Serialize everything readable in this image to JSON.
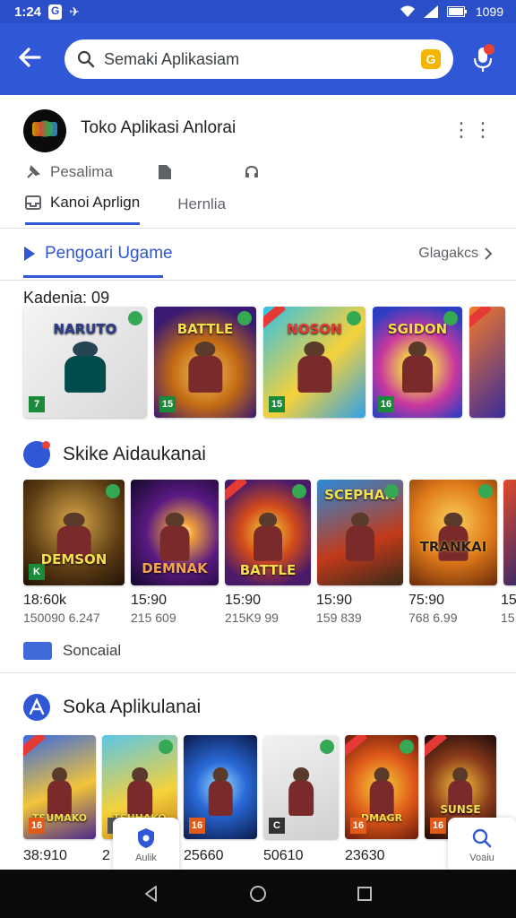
{
  "status_bar": {
    "time": "1:24",
    "battery": "1099",
    "left_icon_1": "G",
    "left_icon_2": "✈"
  },
  "search": {
    "placeholder": "Semaki Aplikasiam",
    "badge": "G"
  },
  "store": {
    "title": "Toko Aplikasi Anlorai",
    "more": "⋮⋮"
  },
  "icon_row": {
    "label_1": "Pesalima"
  },
  "tabs": [
    {
      "label": "Kanoi Aprlign"
    },
    {
      "label": "Hernlia"
    }
  ],
  "section1": {
    "title": "Pengoari Ugame",
    "see_more": "Glagakcs"
  },
  "row1": {
    "label": "Kadenia: 09",
    "cards": [
      {
        "title": "NARUTO",
        "rating": "7"
      },
      {
        "title": "BATTLE",
        "rating": "15"
      },
      {
        "title": "NOSON",
        "rating": "15"
      },
      {
        "title": "SGIDON",
        "rating": "16"
      },
      {
        "title": "",
        "rating": ""
      }
    ]
  },
  "section2": {
    "title": "Skike Aidaukanai",
    "items": [
      {
        "title": "DEMSON",
        "price": "18:60k",
        "sub": "150090 6.247",
        "rating": "K"
      },
      {
        "title": "DEMNAK",
        "price": "15:90",
        "sub": "215 609",
        "rating": ""
      },
      {
        "title": "BATTLE",
        "price": "15:90",
        "sub": "215K9 99",
        "rating": ""
      },
      {
        "title": "SCEPHAN",
        "price": "15:90",
        "sub": "159 839",
        "rating": ""
      },
      {
        "title": "TRANKAI",
        "price": "75:90",
        "sub": "768 6.99",
        "rating": ""
      },
      {
        "title": "",
        "price": "15",
        "sub": "15",
        "rating": ""
      }
    ]
  },
  "social": {
    "badge": "",
    "label": "Soncaial"
  },
  "section3": {
    "title": "Soka Aplikulanai",
    "items": [
      {
        "title": "TSUMAKO",
        "price": "38:910",
        "rating": "16"
      },
      {
        "title": "TSUHAKO",
        "price": "2",
        "rating": "E"
      },
      {
        "title": "",
        "price": "25660",
        "rating": "16"
      },
      {
        "title": "",
        "price": "50610",
        "rating": "C"
      },
      {
        "title": "DMAGR",
        "price": "23630",
        "rating": "16"
      },
      {
        "title": "SUNSE",
        "price": "",
        "rating": "16"
      }
    ]
  },
  "bottom_tabs": {
    "left_label": "Aulik",
    "right_label": "Voaiu"
  },
  "colors": {
    "accent": "#2f57d6",
    "appbar": "#2f57d6",
    "status": "#2a4fc9"
  }
}
